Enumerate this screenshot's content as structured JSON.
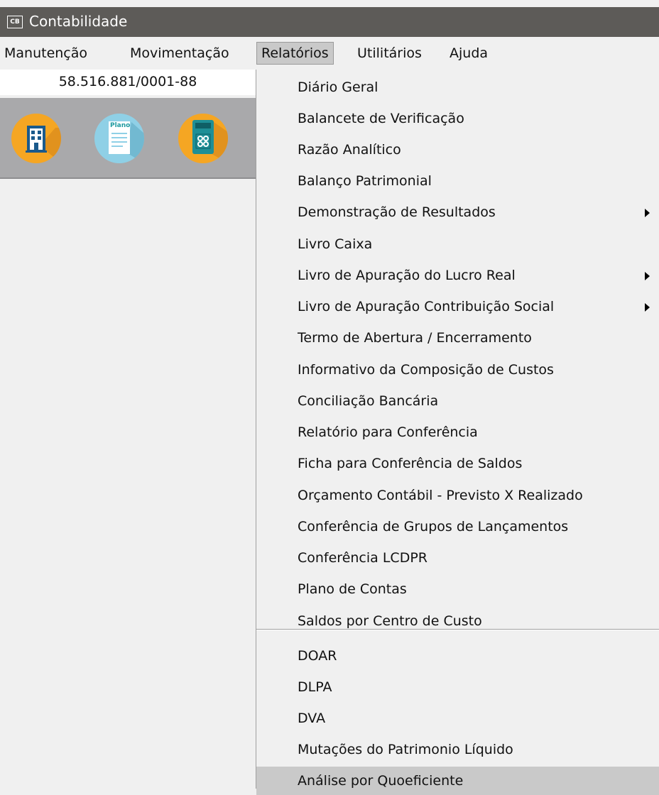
{
  "app": {
    "title": "Contabilidade",
    "icon_text": "CB"
  },
  "menubar": [
    "Manutenção",
    "Movimentação",
    "Relatórios",
    "Utilitários",
    "Ajuda"
  ],
  "company": {
    "cnpj": "58.516.881/0001-88"
  },
  "toolbar": {
    "buttons": [
      {
        "icon": "building-icon"
      },
      {
        "icon": "plano-document-icon",
        "label": "Plano"
      },
      {
        "icon": "calculator-icon"
      }
    ]
  },
  "colors": {
    "orange": "#f5a623",
    "teal": "#1e9aa0",
    "lightblue": "#8fd0e6",
    "menu_highlight": "#c9c9c9"
  },
  "dropdown": {
    "items": [
      "Diário Geral",
      "Balancete de Verificação",
      "Razão Analítico",
      "Balanço Patrimonial",
      "Demonstração de Resultados",
      "Livro Caixa",
      "Livro de Apuração do Lucro Real",
      "Livro de Apuração Contribuição Social",
      "Termo de Abertura / Encerramento",
      "Informativo da Composição de Custos",
      "Conciliação Bancária",
      "Relatório para Conferência",
      "Ficha para Conferência de Saldos",
      "Orçamento Contábil - Previsto X Realizado",
      "Conferência de Grupos de Lançamentos",
      "Conferência LCDPR",
      "Plano de Contas",
      "Saldos por Centro de Custo"
    ],
    "items2": [
      "DOAR",
      "DLPA",
      "DVA",
      "Mutações do Patrimonio Líquido",
      "Análise por Quoeficiente"
    ]
  }
}
